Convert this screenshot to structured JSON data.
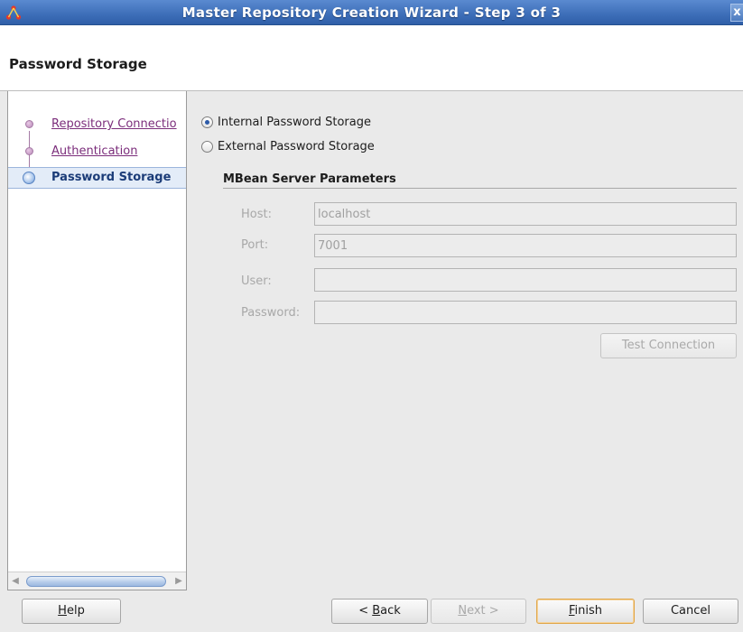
{
  "window": {
    "title": "Master Repository Creation Wizard - Step 3 of 3",
    "close_glyph": "x",
    "icon": "oracle-app-icon"
  },
  "header": {
    "page_title": "Password Storage"
  },
  "steps": [
    {
      "label": "Repository Connectio",
      "state": "visited"
    },
    {
      "label": "Authentication",
      "state": "visited"
    },
    {
      "label": "Password Storage",
      "state": "current"
    }
  ],
  "storage_options": {
    "internal_label": "Internal Password Storage",
    "external_label": "External Password Storage",
    "selected": "internal"
  },
  "mbean": {
    "section_title": "MBean Server Parameters",
    "host_label": "Host:",
    "host_value": "localhost",
    "port_label": "Port:",
    "port_value": "7001",
    "user_label": "User:",
    "user_value": "",
    "password_label": "Password:",
    "password_value": "",
    "test_connection_label": "Test Connection"
  },
  "footer": {
    "help_label": "Help",
    "back_label": "Back",
    "next_label": "Next",
    "finish_label": "Finish",
    "cancel_label": "Cancel"
  },
  "colors": {
    "title_bar": "#3d6eb8",
    "visited_link": "#7b2d7b",
    "current_step": "#1b3c78",
    "default_button_border": "#e0a64a"
  }
}
